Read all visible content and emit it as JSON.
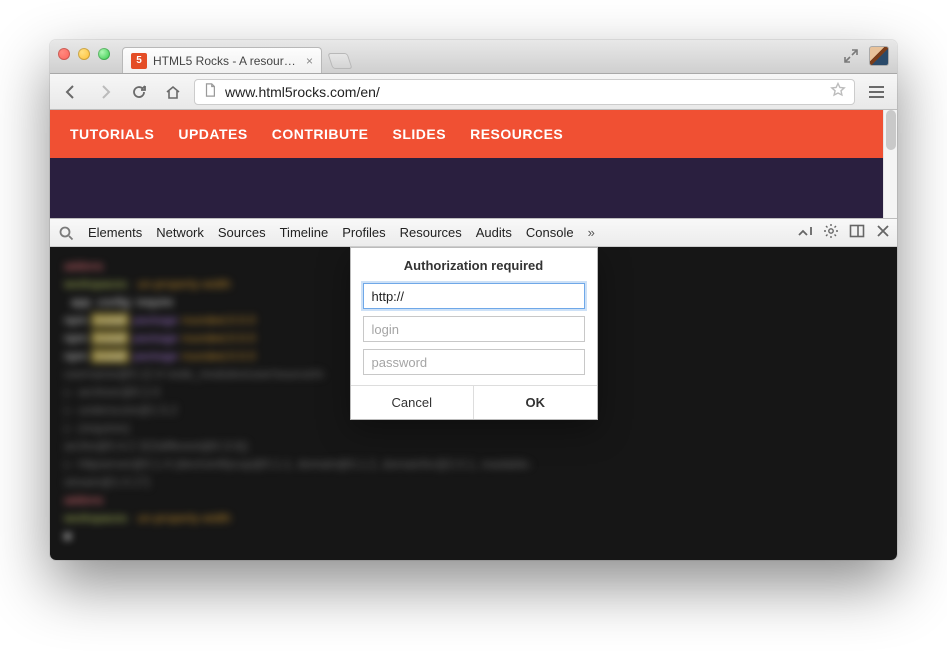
{
  "window": {
    "tab_title": "HTML5 Rocks - A resource..."
  },
  "toolbar": {
    "url": "www.html5rocks.com/en/"
  },
  "nav": {
    "items": [
      "TUTORIALS",
      "UPDATES",
      "CONTRIBUTE",
      "SLIDES",
      "RESOURCES"
    ]
  },
  "devtools": {
    "tabs": [
      "Elements",
      "Network",
      "Sources",
      "Timeline",
      "Profiles",
      "Resources",
      "Audits",
      "Console"
    ]
  },
  "modal": {
    "title": "Authorization required",
    "url_value": "http://",
    "login_placeholder": "login",
    "password_placeholder": "password",
    "cancel": "Cancel",
    "ok": "OK"
  }
}
